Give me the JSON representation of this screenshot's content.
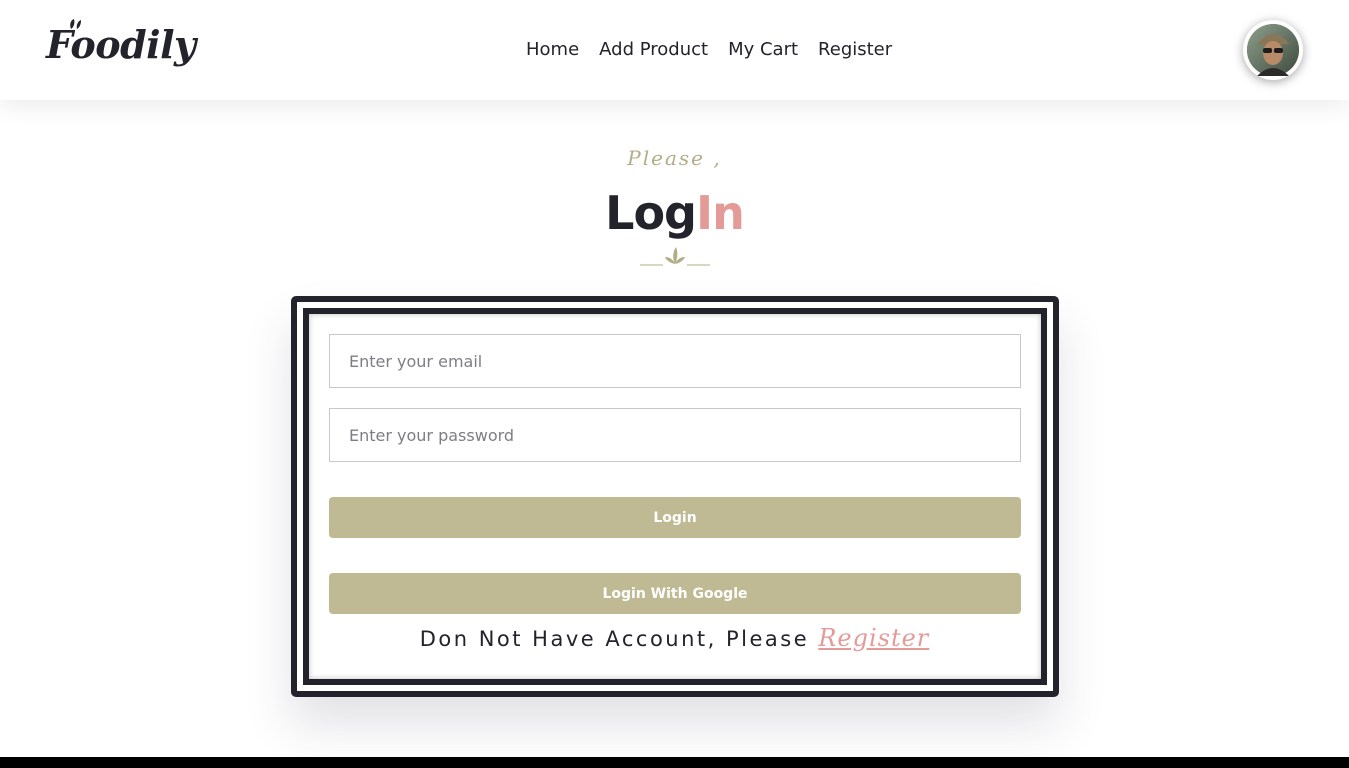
{
  "brand": {
    "name": "Foodily"
  },
  "nav": {
    "items": [
      {
        "label": "Home"
      },
      {
        "label": "Add Product"
      },
      {
        "label": "My Cart"
      },
      {
        "label": "Register"
      }
    ]
  },
  "heading": {
    "subtitle": "Please ,",
    "title_part1": "Log",
    "title_part2": "In"
  },
  "form": {
    "email_placeholder": "Enter your email",
    "email_value": "",
    "password_placeholder": "Enter your password",
    "password_value": "",
    "login_label": "Login",
    "google_label": "Login With Google",
    "register_prompt": "Don Not Have Account, Please ",
    "register_link": "Register"
  },
  "colors": {
    "accent": "#bfb994",
    "pink": "#e49b98",
    "dark": "#23232b"
  },
  "icons": {
    "avatar": "user-avatar",
    "logo_leaf": "leaf-icon",
    "divider": "leaf-divider-icon"
  }
}
